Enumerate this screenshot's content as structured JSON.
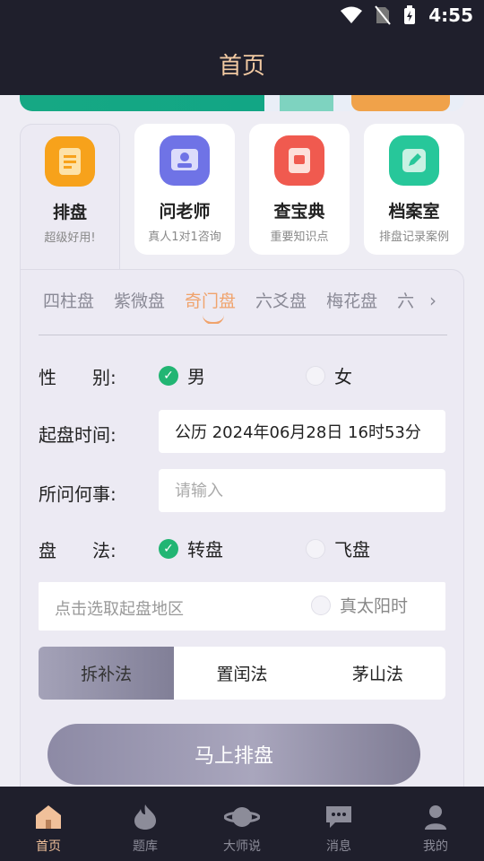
{
  "status_bar": {
    "time": "4:55"
  },
  "header": {
    "title": "首页"
  },
  "cards": [
    {
      "name": "排盘",
      "sub": "超级好用!",
      "icon": "document-icon",
      "color": "#f7a21b"
    },
    {
      "name": "问老师",
      "sub": "真人1对1咨询",
      "icon": "teacher-icon",
      "color": "#6f73e6"
    },
    {
      "name": "查宝典",
      "sub": "重要知识点",
      "icon": "treasure-book-icon",
      "color": "#f05a4f"
    },
    {
      "name": "档案室",
      "sub": "排盘记录案例",
      "icon": "edit-file-icon",
      "color": "#27c79a"
    }
  ],
  "tabs": [
    "四柱盘",
    "紫微盘",
    "奇门盘",
    "六爻盘",
    "梅花盘",
    "六"
  ],
  "active_tab": "奇门盘",
  "form": {
    "gender_label": "性　　别:",
    "gender_male": "男",
    "gender_female": "女",
    "time_label": "起盘时间:",
    "time_value": "公历 2024年06月28日 16时53分",
    "question_label": "所问何事:",
    "question_placeholder": "请输入",
    "method_label": "盘　　法:",
    "method_zhuan": "转盘",
    "method_fei": "飞盘",
    "region_placeholder": "点击选取起盘地区",
    "true_solar": "真太阳时"
  },
  "methods": [
    "拆补法",
    "置闰法",
    "茅山法"
  ],
  "submit_label": "马上排盘",
  "nav": [
    {
      "label": "首页",
      "icon": "home-icon"
    },
    {
      "label": "题库",
      "icon": "flame-icon"
    },
    {
      "label": "大师说",
      "icon": "planet-icon"
    },
    {
      "label": "消息",
      "icon": "message-icon"
    },
    {
      "label": "我的",
      "icon": "user-icon"
    }
  ],
  "colors": {
    "accent": "#f0a36c",
    "header_bg": "#1f1f2c",
    "check": "#22b573"
  }
}
